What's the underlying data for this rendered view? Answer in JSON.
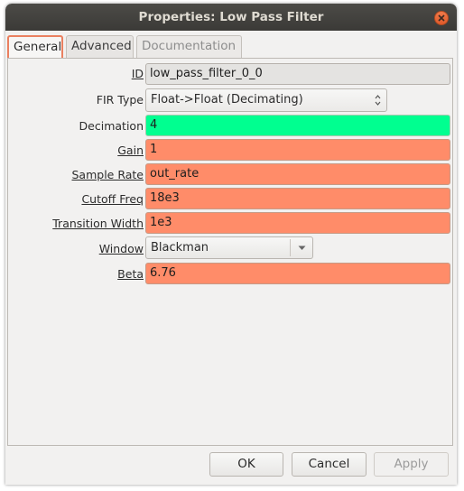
{
  "window": {
    "title": "Properties: Low Pass Filter"
  },
  "tabs": [
    {
      "label": "General",
      "active": true
    },
    {
      "label": "Advanced",
      "active": false
    },
    {
      "label": "Documentation",
      "active": false,
      "disabled": true
    }
  ],
  "fields": {
    "id": {
      "label": "ID",
      "value": "low_pass_filter_0_0"
    },
    "fir_type": {
      "label": "FIR Type",
      "value": "Float->Float (Decimating)"
    },
    "decimation": {
      "label": "Decimation",
      "value": "4"
    },
    "gain": {
      "label": "Gain",
      "value": "1"
    },
    "sample_rate": {
      "label": "Sample Rate",
      "value": "out_rate"
    },
    "cutoff_freq": {
      "label": "Cutoff Freq",
      "value": "18e3"
    },
    "transition_width": {
      "label": "Transition Width",
      "value": "1e3"
    },
    "window": {
      "label": "Window",
      "value": "Blackman"
    },
    "beta": {
      "label": "Beta",
      "value": "6.76"
    }
  },
  "buttons": {
    "ok": "OK",
    "cancel": "Cancel",
    "apply": "Apply"
  },
  "colors": {
    "valid_field": "#00ff90",
    "warning_field": "#ff8c69",
    "titlebar": "#3b3a37",
    "close_button": "#e05a2a"
  },
  "icons": {
    "close": "close-icon",
    "spin": "up-down-spin-icon",
    "dropdown": "chevron-down-icon"
  }
}
